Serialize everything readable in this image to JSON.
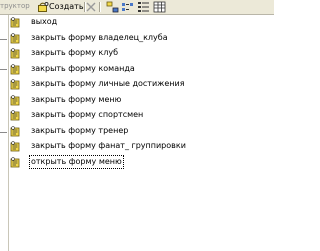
{
  "toolbar": {
    "cut_text": "труктор",
    "create_label": "Создать"
  },
  "macros": [
    {
      "label": "выход"
    },
    {
      "label": "закрыть форму владелец_клуба"
    },
    {
      "label": "закрыть форму клуб"
    },
    {
      "label": "закрыть форму команда"
    },
    {
      "label": "закрыть форму личные достижения"
    },
    {
      "label": "закрыть форму меню"
    },
    {
      "label": "закрыть форму спортсмен"
    },
    {
      "label": "закрыть форму тренер"
    },
    {
      "label": "закрыть форму фанат_ группировки"
    },
    {
      "label": "открыть форму меню"
    }
  ],
  "focused_index": 9,
  "colors": {
    "toolbar_bg": "#ece9d8",
    "macro_icon_yellow": "#f2d94a"
  }
}
